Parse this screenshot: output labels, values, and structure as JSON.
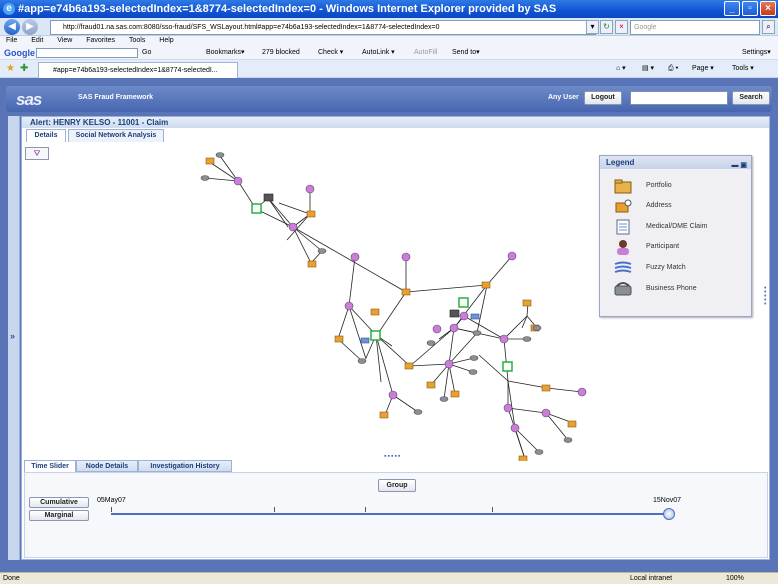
{
  "window": {
    "title": "#app=e74b6a193-selectedIndex=1&8774-selectedIndex=0 - Windows Internet Explorer provided by SAS",
    "url": "http://fraud01.na.sas.com:8080/sso-fraud/SFS_WSLayout.html#app=e74b6a193-selectedIndex=1&8774-selectedIndex=0",
    "search_placeholder": "Google",
    "menu": [
      "File",
      "Edit",
      "View",
      "Favorites",
      "Tools",
      "Help"
    ],
    "google_toolbar": {
      "logo": "Google",
      "go": "Go",
      "bookmarks": "Bookmarks▾",
      "blocked": "279 blocked",
      "check": "Check ▾",
      "autolink": "AutoLink ▾",
      "autofill": "AutoFill",
      "sendto": "Send to▾",
      "settings": "Settings▾"
    },
    "tab_title": "#app=e74b6a193-selectedIndex=1&8774-selectedI...",
    "page_menu": "Page ▾",
    "tools_menu": "Tools ▾"
  },
  "app": {
    "logo": "sas",
    "title": "SAS Fraud Framework",
    "user": "Any User",
    "logout": "Logout",
    "search": "Search",
    "alert_header": "Alert:  HENRY KELSO - 11001 - Claim",
    "tabs": [
      {
        "label": "Details",
        "active": true
      },
      {
        "label": "Social Network Analysis",
        "active": false
      }
    ],
    "legend": {
      "title": "Legend",
      "items": [
        {
          "label": "Portfolio",
          "icon": "portfolio-icon"
        },
        {
          "label": "Address",
          "icon": "address-icon"
        },
        {
          "label": "Medical/DME Claim",
          "icon": "claim-icon"
        },
        {
          "label": "Participant",
          "icon": "participant-icon"
        },
        {
          "label": "Fuzzy Match",
          "icon": "fuzzy-match-icon"
        },
        {
          "label": "Business Phone",
          "icon": "phone-icon"
        }
      ]
    },
    "bottom_tabs": [
      {
        "label": "Time Slider",
        "active": true
      },
      {
        "label": "Node Details",
        "active": false
      },
      {
        "label": "Investigation History",
        "active": false
      }
    ],
    "group_button": "Group",
    "cumulative_button": "Cumulative",
    "marginal_button": "Marginal",
    "slider": {
      "start": "05May07",
      "end": "15Nov07",
      "position": 1.0
    }
  },
  "status": {
    "left": "Done",
    "zone": "Local intranet",
    "zoom": "100%"
  },
  "colors": {
    "address": "#e8a030",
    "participant": "#c97fd6",
    "claim_border": "#27b13b",
    "phone": "#8a8f96",
    "fuzzy": "#6f91d8",
    "edge": "#222222"
  }
}
